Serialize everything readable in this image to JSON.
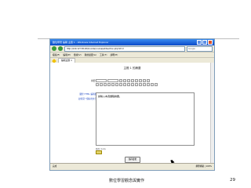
{
  "browser": {
    "title": "數位學習 編輯 主題 1 - Windows Internet Explorer",
    "address": "http://140.127.58.28/moodle/course/editsection.php?id=2",
    "search_placeholder": "Google",
    "menus": [
      "檔案(F)",
      "編輯(E)",
      "檢視(V)",
      "我的最愛(A)",
      "工具(T)",
      "說明(H)"
    ],
    "favorites_tab": "編輯主題 1"
  },
  "page": {
    "title": "主題 1 的摘要",
    "font_label": "摘要:",
    "font_select": "Trebuchet",
    "size_select": "1 (8 pt)",
    "side_links": [
      "關於 HTML 編輯器",
      "如何寫一個好的文字"
    ],
    "editor_text": "請輸入本週課程摘要。",
    "path_label": "路徑: body",
    "submit_label": "儲存變更",
    "status_left": "完成",
    "status_right": "網際網路 | 100%"
  },
  "slide": {
    "footer": "數位學習觀念與實作",
    "page_number": "29"
  }
}
